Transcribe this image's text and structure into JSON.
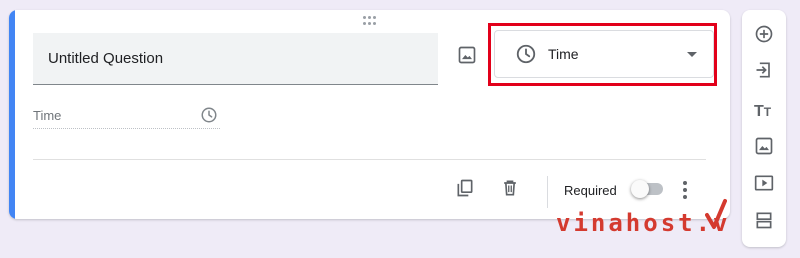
{
  "question": {
    "title": "Untitled Question",
    "type_selected": "Time",
    "answer_placeholder": "Time"
  },
  "footer": {
    "required_label": "Required",
    "required_enabled": false
  },
  "side_toolbar": {
    "items": [
      "add-question",
      "import-questions",
      "add-title-description",
      "add-image",
      "add-video",
      "add-section"
    ]
  },
  "watermark": {
    "brand": "vinahost.v"
  },
  "colors": {
    "accent": "#4285f4",
    "highlight": "#e2001a",
    "background": "#efebf7",
    "watermark": "#d43a2f"
  }
}
